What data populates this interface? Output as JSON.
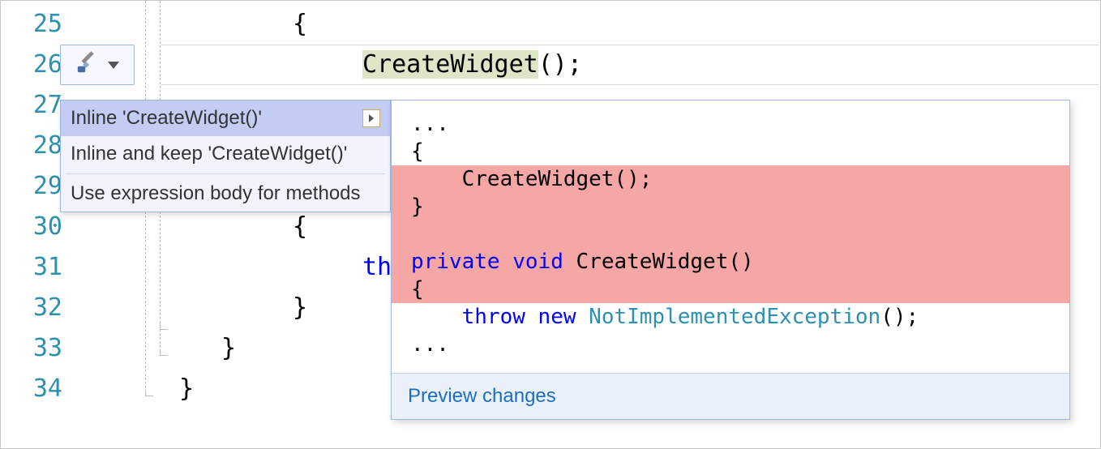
{
  "line_numbers": [
    "25",
    "26",
    "27",
    "28",
    "29",
    "30",
    "31",
    "32",
    "33",
    "34"
  ],
  "code": {
    "l25": "{",
    "l26_call": "CreateWidget",
    "l26_tail": "();",
    "l30": "{",
    "l31_throw": "th",
    "l32": "}",
    "l33": "}",
    "l34": "}"
  },
  "quick_actions": {
    "item1": "Inline 'CreateWidget()'",
    "item2": "Inline and keep 'CreateWidget()'",
    "item3": "Use expression body for methods"
  },
  "preview": {
    "ellipsis1": "...",
    "open_brace": "{",
    "call_line": "    CreateWidget();",
    "close_brace": "}",
    "blank": "",
    "sig_private": "private",
    "sig_void": " void",
    "sig_name": " CreateWidget()",
    "open_brace2": "{",
    "throw": "    throw",
    "new": " new",
    "exc_type": " NotImplementedException",
    "exc_tail": "();",
    "ellipsis2": "...",
    "footer": "Preview changes"
  }
}
